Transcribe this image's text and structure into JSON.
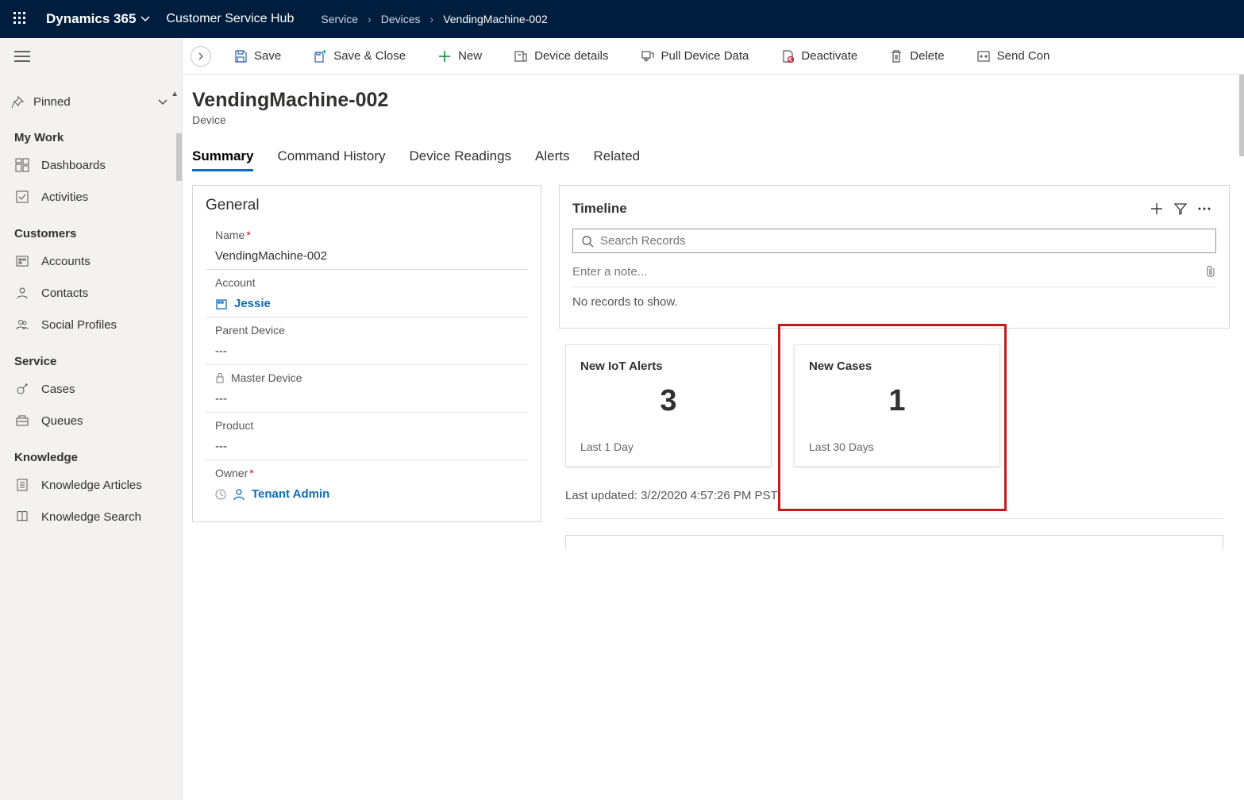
{
  "topnav": {
    "brand": "Dynamics 365",
    "hub": "Customer Service Hub",
    "crumbs": [
      "Service",
      "Devices",
      "VendingMachine-002"
    ]
  },
  "sidebar": {
    "pinned": "Pinned",
    "groups": [
      {
        "label": "My Work",
        "items": [
          {
            "key": "dashboards",
            "label": "Dashboards"
          },
          {
            "key": "activities",
            "label": "Activities"
          }
        ]
      },
      {
        "label": "Customers",
        "items": [
          {
            "key": "accounts",
            "label": "Accounts"
          },
          {
            "key": "contacts",
            "label": "Contacts"
          },
          {
            "key": "social-profiles",
            "label": "Social Profiles"
          }
        ]
      },
      {
        "label": "Service",
        "items": [
          {
            "key": "cases",
            "label": "Cases"
          },
          {
            "key": "queues",
            "label": "Queues"
          }
        ]
      },
      {
        "label": "Knowledge",
        "items": [
          {
            "key": "knowledge-articles",
            "label": "Knowledge Articles"
          },
          {
            "key": "knowledge-search",
            "label": "Knowledge Search"
          }
        ]
      }
    ]
  },
  "commands": {
    "save": "Save",
    "save_close": "Save & Close",
    "new": "New",
    "device_details": "Device details",
    "pull": "Pull Device Data",
    "deactivate": "Deactivate",
    "delete": "Delete",
    "send": "Send Con"
  },
  "record": {
    "title": "VendingMachine-002",
    "entity": "Device",
    "tabs": [
      "Summary",
      "Command History",
      "Device Readings",
      "Alerts",
      "Related"
    ],
    "active_tab": 0
  },
  "general": {
    "section": "General",
    "name_label": "Name",
    "name_value": "VendingMachine-002",
    "account_label": "Account",
    "account_value": "Jessie",
    "parent_label": "Parent Device",
    "parent_value": "---",
    "master_label": "Master Device",
    "master_value": "---",
    "product_label": "Product",
    "product_value": "---",
    "owner_label": "Owner",
    "owner_value": "Tenant Admin"
  },
  "timeline": {
    "title": "Timeline",
    "search_placeholder": "Search Records",
    "note_placeholder": "Enter a note...",
    "empty": "No records to show."
  },
  "cards": {
    "iot_title": "New IoT Alerts",
    "iot_count": "3",
    "iot_footer": "Last 1 Day",
    "cases_title": "New Cases",
    "cases_count": "1",
    "cases_footer": "Last 30 Days",
    "last_updated": "Last updated: 3/2/2020 4:57:26 PM PST"
  }
}
